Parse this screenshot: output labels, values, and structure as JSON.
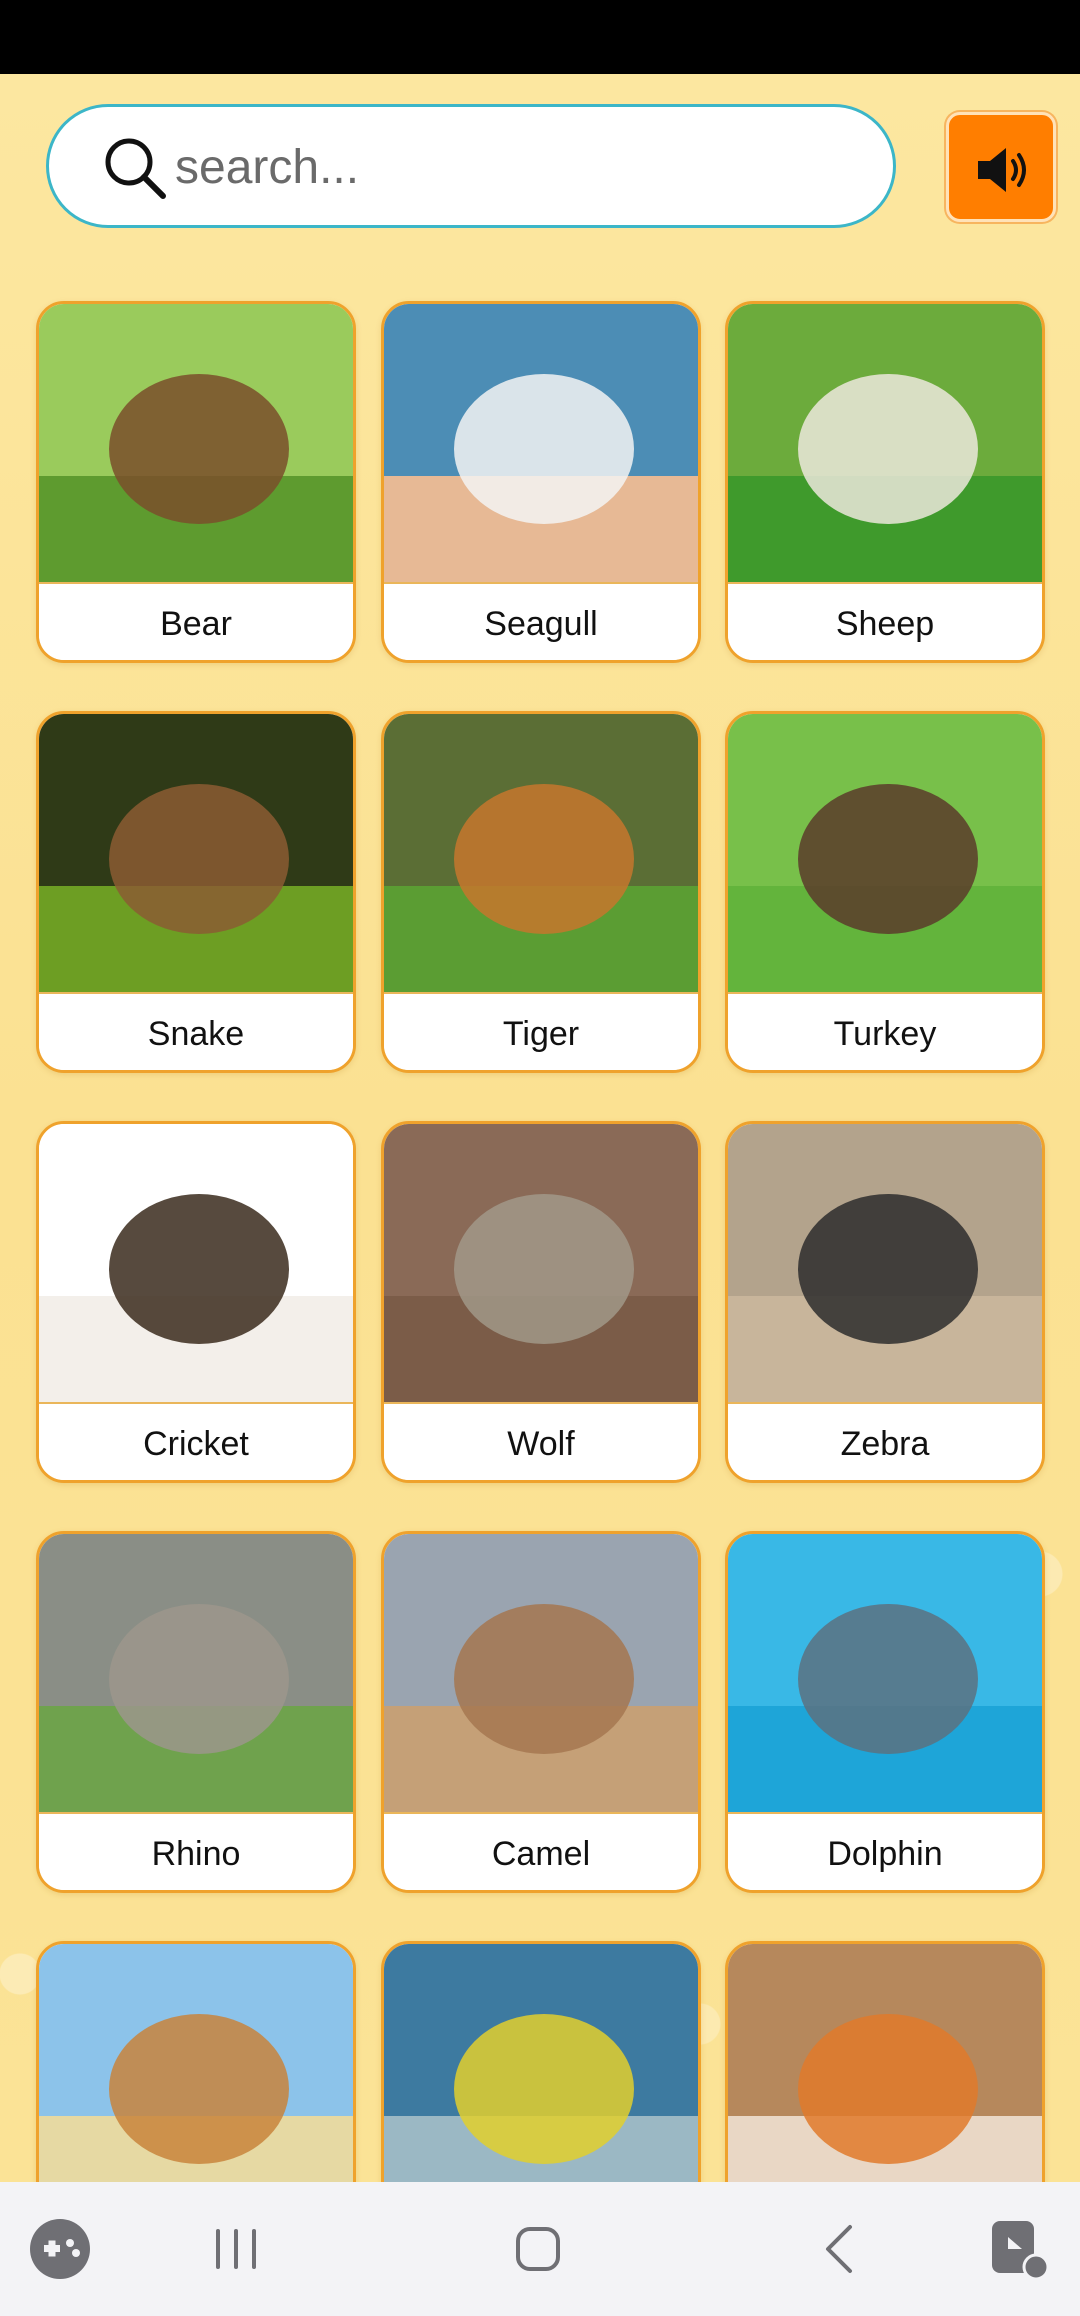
{
  "search": {
    "placeholder": "search..."
  },
  "sound": {
    "icon": "speaker-icon",
    "color": "#ff7e00"
  },
  "animals": [
    {
      "label": "Bear",
      "sky": "#9acb5c",
      "ground": "#5e9b2f",
      "subject": "#7a4f2a"
    },
    {
      "label": "Seagull",
      "sky": "#4c8db5",
      "ground": "#e7b995",
      "subject": "#f3f3f3"
    },
    {
      "label": "Sheep",
      "sky": "#6cab3c",
      "ground": "#3f9a2c",
      "subject": "#ece8dc"
    },
    {
      "label": "Snake",
      "sky": "#2f3a17",
      "ground": "#6d9e23",
      "subject": "#8b5c33"
    },
    {
      "label": "Tiger",
      "sky": "#5b6e35",
      "ground": "#5b9d33",
      "subject": "#c7772d"
    },
    {
      "label": "Turkey",
      "sky": "#78c04a",
      "ground": "#63b43c",
      "subject": "#5a3b2a"
    },
    {
      "label": "Cricket",
      "sky": "#ffffff",
      "ground": "#f3efea",
      "subject": "#3a2a1c"
    },
    {
      "label": "Wolf",
      "sky": "#8a6a57",
      "ground": "#7b5c48",
      "subject": "#a19888"
    },
    {
      "label": "Zebra",
      "sky": "#b3a38c",
      "ground": "#c8b59b",
      "subject": "#2d2d2d"
    },
    {
      "label": "Rhino",
      "sky": "#8a8e86",
      "ground": "#6fa24d",
      "subject": "#9c968c"
    },
    {
      "label": "Camel",
      "sky": "#9aa4b0",
      "ground": "#c5a077",
      "subject": "#a47750"
    },
    {
      "label": "Dolphin",
      "sky": "#39b8e6",
      "ground": "#1ea5d8",
      "subject": "#5c7180"
    },
    {
      "label": "",
      "sky": "#8cc3ea",
      "ground": "#e6d9a3",
      "subject": "#c8843c"
    },
    {
      "label": "",
      "sky": "#3d7aa0",
      "ground": "#9bb8c4",
      "subject": "#e2cf2d"
    },
    {
      "label": "",
      "sky": "#b6885c",
      "ground": "#e9d7c5",
      "subject": "#e07a2a"
    }
  ],
  "nav": {
    "game_icon": "game-launcher-icon",
    "recents_icon": "recent-apps-icon",
    "home_icon": "home-icon",
    "back_icon": "back-icon",
    "accessibility_icon": "touch-accessibility-icon"
  }
}
